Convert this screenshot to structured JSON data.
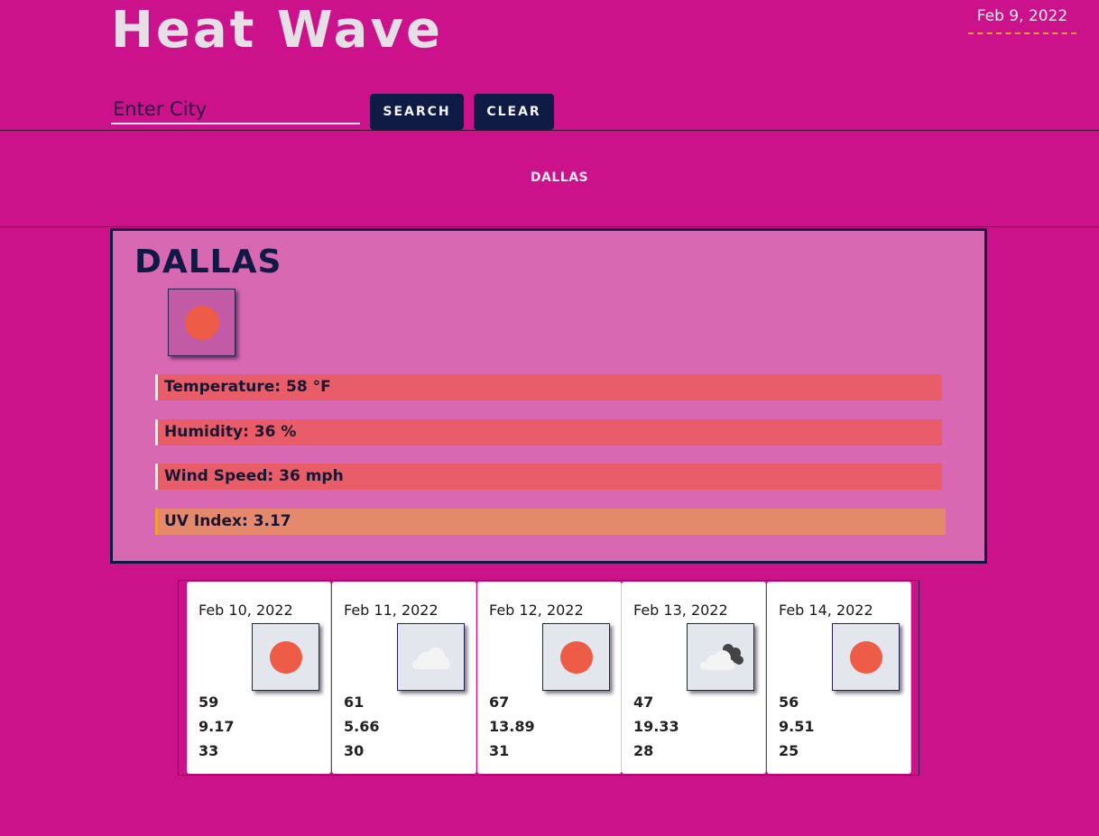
{
  "header": {
    "app_title": "Heat Wave",
    "current_date": "Feb 9, 2022"
  },
  "search": {
    "placeholder": "Enter City",
    "value": "",
    "search_label": "SEARCH",
    "clear_label": "CLEAR"
  },
  "history": {
    "items": [
      "DALLAS"
    ]
  },
  "current": {
    "city": "DALLAS",
    "icon": "clear-sun-icon",
    "temperature": "Temperature: 58 °F",
    "humidity": "Humidity: 36 %",
    "wind_speed": "Wind Speed: 36 mph",
    "uv_index": "UV Index: 3.17"
  },
  "forecast": [
    {
      "date": "Feb 10, 2022",
      "icon": "clear-sun-icon",
      "temp": "59",
      "wind": "9.17",
      "humidity": "33"
    },
    {
      "date": "Feb 11, 2022",
      "icon": "cloud-icon",
      "temp": "61",
      "wind": "5.66",
      "humidity": "30"
    },
    {
      "date": "Feb 12, 2022",
      "icon": "clear-sun-icon",
      "temp": "67",
      "wind": "13.89",
      "humidity": "31"
    },
    {
      "date": "Feb 13, 2022",
      "icon": "broken-clouds-icon",
      "temp": "47",
      "wind": "19.33",
      "humidity": "28"
    },
    {
      "date": "Feb 14, 2022",
      "icon": "clear-sun-icon",
      "temp": "56",
      "wind": "9.51",
      "humidity": "25"
    }
  ],
  "colors": {
    "background": "#cc128b",
    "card": "#d968b3",
    "navy": "#0f1a45",
    "stat_bar": "#e85d67",
    "uv_bar": "#e5896c",
    "sun": "#ee5c48"
  }
}
